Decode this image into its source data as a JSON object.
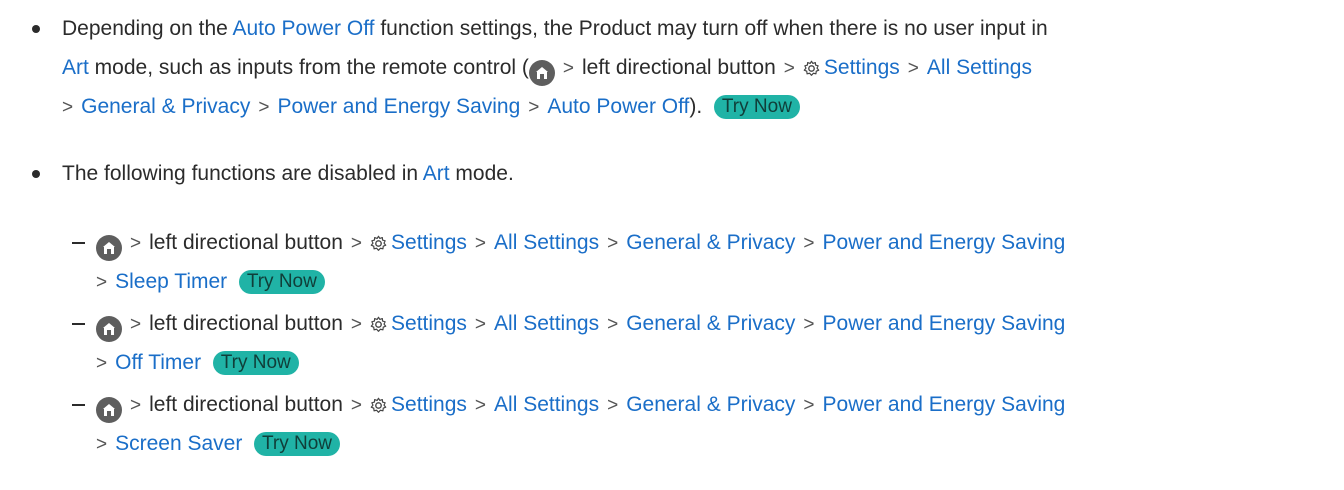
{
  "bullet1": {
    "text1": "Depending on the ",
    "auto_power_off": "Auto Power Off",
    "text2": " function settings, the Product may turn off when there is no user input in",
    "art": "Art",
    "text3": " mode, such as inputs from the remote control (",
    "left_button": "left directional button",
    "settings": "Settings",
    "all_settings": "All Settings",
    "general_privacy": "General & Privacy",
    "power_energy": "Power and Energy Saving",
    "auto_power_off_2": "Auto Power Off",
    "close": ").",
    "try_now": "Try Now"
  },
  "bullet2": {
    "text1": "The following functions are disabled in ",
    "art": "Art",
    "text2": " mode."
  },
  "path": {
    "separator": ">",
    "left_button": "left directional button",
    "settings": "Settings",
    "all_settings": "All Settings",
    "general_privacy": "General & Privacy",
    "power_energy": "Power and Energy Saving",
    "try_now": "Try Now"
  },
  "sub_items": [
    {
      "final": "Sleep Timer"
    },
    {
      "final": "Off Timer"
    },
    {
      "final": "Screen Saver"
    }
  ],
  "icons": {
    "home": "home-icon",
    "settings": "gear-icon"
  },
  "colors": {
    "link": "#1a6ec8",
    "try_now_bg": "#20b3a6",
    "text": "#2b2b2b"
  }
}
